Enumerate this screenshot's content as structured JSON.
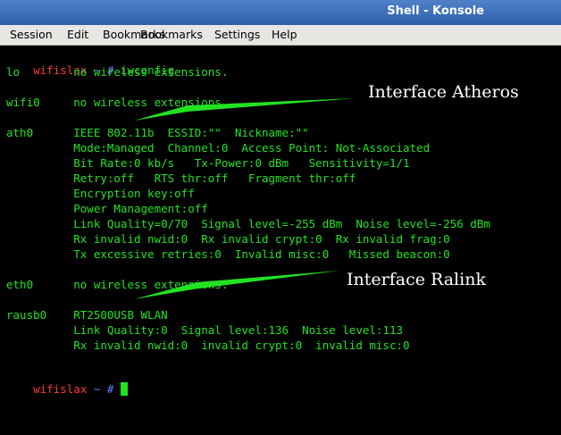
{
  "window": {
    "title": "Shell - Konsole"
  },
  "menu": [
    "Session",
    "Edit",
    "Bookmarks",
    "Settings",
    "Help"
  ],
  "terminal": {
    "prompt_user": "wifislax",
    "prompt_rest": " ~ #",
    "command": " iwconfig",
    "lines": [
      "lo        no wireless extensions.",
      "",
      "wifi0     no wireless extensions.",
      "",
      "ath0      IEEE 802.11b  ESSID:\"\"  Nickname:\"\"",
      "          Mode:Managed  Channel:0  Access Point: Not-Associated",
      "          Bit Rate:0 kb/s   Tx-Power:0 dBm   Sensitivity=1/1",
      "          Retry:off   RTS thr:off   Fragment thr:off",
      "          Encryption key:off",
      "          Power Management:off",
      "          Link Quality=0/70  Signal level=-255 dBm  Noise level=-256 dBm",
      "          Rx invalid nwid:0  Rx invalid crypt:0  Rx invalid frag:0",
      "          Tx excessive retries:0  Invalid misc:0   Missed beacon:0",
      "",
      "eth0      no wireless extensions.",
      "",
      "rausb0    RT2500USB WLAN",
      "          Link Quality:0  Signal level:136  Noise level:113",
      "          Rx invalid nwid:0  invalid crypt:0  invalid misc:0",
      "",
      ""
    ]
  },
  "annotations": {
    "atheros": "Interface Atheros",
    "ralink": "Interface Ralink"
  },
  "colors": {
    "prompt": "#ff3b3b",
    "tilde": "#6a7dff",
    "text": "#22e322",
    "arrow": "#22e322"
  }
}
